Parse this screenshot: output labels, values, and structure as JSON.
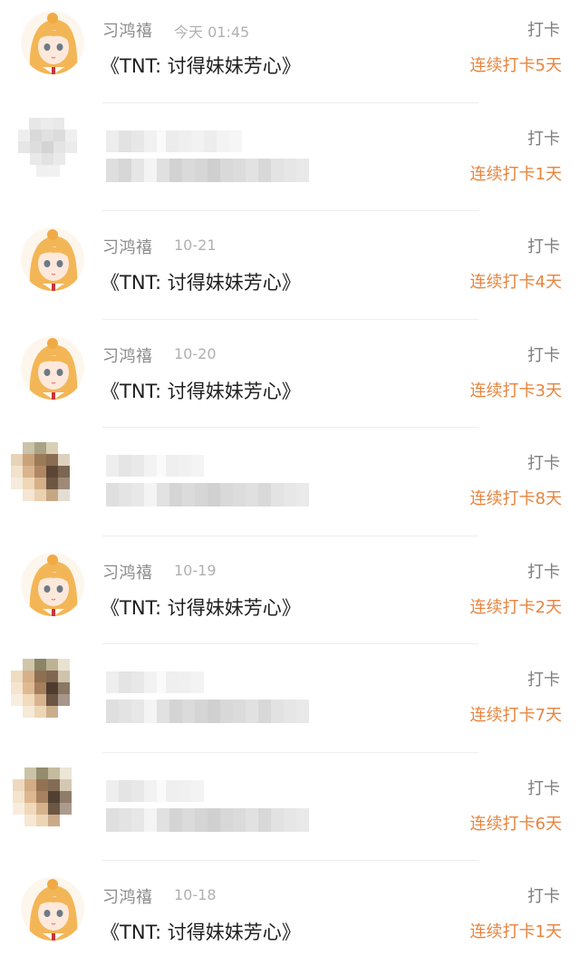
{
  "feed": {
    "rows": [
      {
        "kind": "checkin",
        "name": "习鸿禧",
        "time": "今天 01:45",
        "title": "《TNT: 讨得妹妹芳心》",
        "action": "打卡",
        "streak": "连续打卡5天"
      },
      {
        "kind": "blurred",
        "action": "打卡",
        "streak": "连续打卡1天",
        "avatar_palette": "grey"
      },
      {
        "kind": "checkin",
        "name": "习鸿禧",
        "time": "10-21",
        "title": "《TNT: 讨得妹妹芳心》",
        "action": "打卡",
        "streak": "连续打卡4天"
      },
      {
        "kind": "checkin",
        "name": "习鸿禧",
        "time": "10-20",
        "title": "《TNT: 讨得妹妹芳心》",
        "action": "打卡",
        "streak": "连续打卡3天"
      },
      {
        "kind": "blurred",
        "action": "打卡",
        "streak": "连续打卡8天",
        "avatar_palette": "warm"
      },
      {
        "kind": "checkin",
        "name": "习鸿禧",
        "time": "10-19",
        "title": "《TNT: 讨得妹妹芳心》",
        "action": "打卡",
        "streak": "连续打卡2天"
      },
      {
        "kind": "blurred",
        "action": "打卡",
        "streak": "连续打卡7天",
        "avatar_palette": "warm"
      },
      {
        "kind": "blurred",
        "action": "打卡",
        "streak": "连续打卡6天",
        "avatar_palette": "warm"
      },
      {
        "kind": "checkin",
        "name": "习鸿禧",
        "time": "10-18",
        "title": "《TNT: 讨得妹妹芳心》",
        "action": "打卡",
        "streak": "连续打卡1天"
      }
    ]
  },
  "colors": {
    "streak": "#e8843e",
    "action": "#7e7e7e",
    "name": "#8a8a8a",
    "time": "#b0b0b0",
    "title": "#1f1f1f",
    "divider": "#eeeeee"
  },
  "icons": {
    "avatar": "anime-girl-avatar-icon"
  }
}
